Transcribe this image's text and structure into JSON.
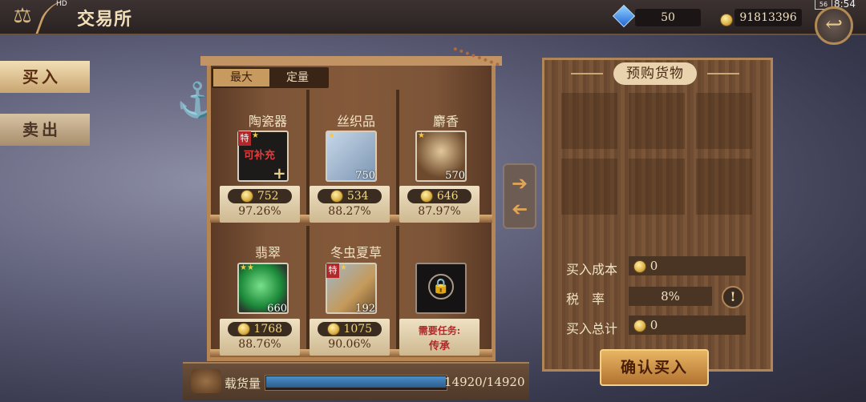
{
  "topbar": {
    "title": "交易所",
    "gems": "50",
    "gold": "91813396",
    "time": "8:54",
    "network": "HD",
    "battery": "56"
  },
  "sidetabs": {
    "buy": "买入",
    "sell": "卖出"
  },
  "filters": {
    "max": "最大",
    "fixed": "定量"
  },
  "goods": [
    {
      "name": "陶瓷器",
      "qty": "",
      "price": "752",
      "pct": "97.26%",
      "badge": "特",
      "overlay": "可补充",
      "stars": 1,
      "icon": "porcelain-icon"
    },
    {
      "name": "丝织品",
      "qty": "750",
      "price": "534",
      "pct": "88.27%",
      "badge": "",
      "overlay": "",
      "stars": 1,
      "icon": "silk-icon"
    },
    {
      "name": "麝香",
      "qty": "570",
      "price": "646",
      "pct": "87.97%",
      "badge": "",
      "overlay": "",
      "stars": 1,
      "icon": "musk-icon"
    },
    {
      "name": "翡翠",
      "qty": "660",
      "price": "1768",
      "pct": "88.76%",
      "badge": "",
      "overlay": "",
      "stars": 2,
      "icon": "jade-icon"
    },
    {
      "name": "冬虫夏草",
      "qty": "192",
      "price": "1075",
      "pct": "90.06%",
      "badge": "特",
      "overlay": "",
      "stars": 1,
      "icon": "cordyceps-icon"
    }
  ],
  "locked": {
    "text1": "需要任务:",
    "text2": "传承",
    "icon": "padlock-icon"
  },
  "panel": {
    "title": "预购货物",
    "cost_label": "买入成本",
    "cost": "0",
    "tax_label": "税　率",
    "tax": "8%",
    "total_label": "买入总计",
    "total": "0",
    "confirm": "确认买入"
  },
  "cargo": {
    "label": "载货量",
    "value": "14920/14920",
    "fill": 1.0
  },
  "colors": {
    "gold_text": "#f3d67d",
    "wood": "#7c5437",
    "accent_red": "#b2272a"
  }
}
